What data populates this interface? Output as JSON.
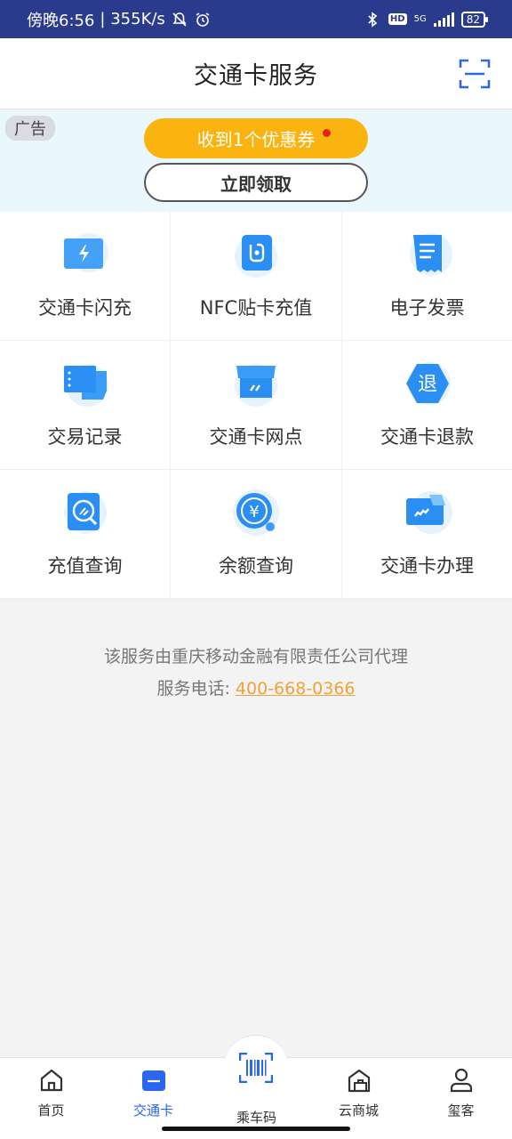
{
  "status_bar": {
    "time": "傍晚6:56",
    "speed": "| 355K/s",
    "battery": "82",
    "network": "5G"
  },
  "header": {
    "title": "交通卡服务"
  },
  "ad": {
    "tag": "广告",
    "coupon_label": "收到1个优惠券",
    "claim_label": "立即领取"
  },
  "services": [
    {
      "label": "交通卡闪充",
      "icon": "flash-charge-icon"
    },
    {
      "label": "NFC贴卡充值",
      "icon": "nfc-icon"
    },
    {
      "label": "电子发票",
      "icon": "invoice-icon"
    },
    {
      "label": "交易记录",
      "icon": "records-icon"
    },
    {
      "label": "交通卡网点",
      "icon": "store-icon"
    },
    {
      "label": "交通卡退款",
      "icon": "refund-icon"
    },
    {
      "label": "充值查询",
      "icon": "recharge-query-icon"
    },
    {
      "label": "余额查询",
      "icon": "balance-query-icon"
    },
    {
      "label": "交通卡办理",
      "icon": "card-apply-icon"
    }
  ],
  "info": {
    "agent_text": "该服务由重庆移动金融有限责任公司代理",
    "phone_label": "服务电话:",
    "phone_number": "400-668-0366"
  },
  "bottom_nav": {
    "items": [
      {
        "label": "首页"
      },
      {
        "label": "交通卡"
      },
      {
        "label": "乘车码"
      },
      {
        "label": "云商城"
      },
      {
        "label": "玺客"
      }
    ],
    "active_index": 1
  },
  "colors": {
    "accent": "#2b66f0",
    "coupon": "#fbb30f",
    "status_bar": "#2a3a8c",
    "phone": "#f0a23a"
  }
}
